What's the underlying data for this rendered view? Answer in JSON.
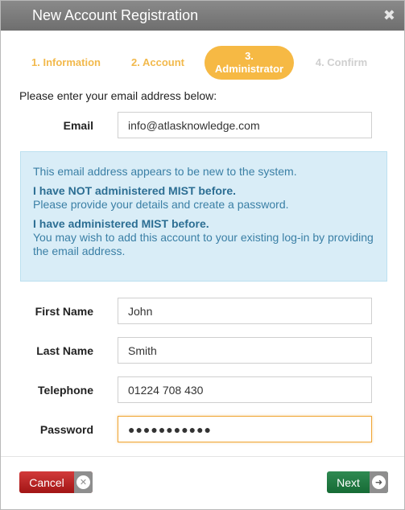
{
  "dialog": {
    "title": "New Account Registration",
    "close_icon": "close-icon"
  },
  "steps": [
    {
      "label": "1. Information",
      "state": "completed"
    },
    {
      "label": "2. Account",
      "state": "completed"
    },
    {
      "number": "3.",
      "label": "Administrator",
      "state": "active"
    },
    {
      "label": "4. Confirm",
      "state": "pending"
    }
  ],
  "intro_text": "Please enter your email address below:",
  "email": {
    "label": "Email",
    "value": "info@atlasknowledge.com"
  },
  "info_box": {
    "line1": "This email address appears to be new to the system.",
    "heading_not": "I have NOT administered MIST before.",
    "text_not": "Please provide your details and create a password.",
    "heading_have": "I have administered MIST before.",
    "text_have": "You may wish to add this account to your existing log-in by providing the email address."
  },
  "form": {
    "first_name": {
      "label": "First Name",
      "value": "John"
    },
    "last_name": {
      "label": "Last Name",
      "value": "Smith"
    },
    "telephone": {
      "label": "Telephone",
      "value": "01224 708 430"
    },
    "password": {
      "label": "Password",
      "value": "●●●●●●●●●●●"
    }
  },
  "buttons": {
    "cancel": {
      "label": "Cancel",
      "icon": "close-circle-icon",
      "color": "#b82020"
    },
    "next": {
      "label": "Next",
      "icon": "arrow-right-circle-icon",
      "color": "#1e7a3f"
    }
  },
  "colors": {
    "accent": "#f6b944",
    "info_bg": "#d9edf7",
    "info_text": "#3a7fa5"
  }
}
